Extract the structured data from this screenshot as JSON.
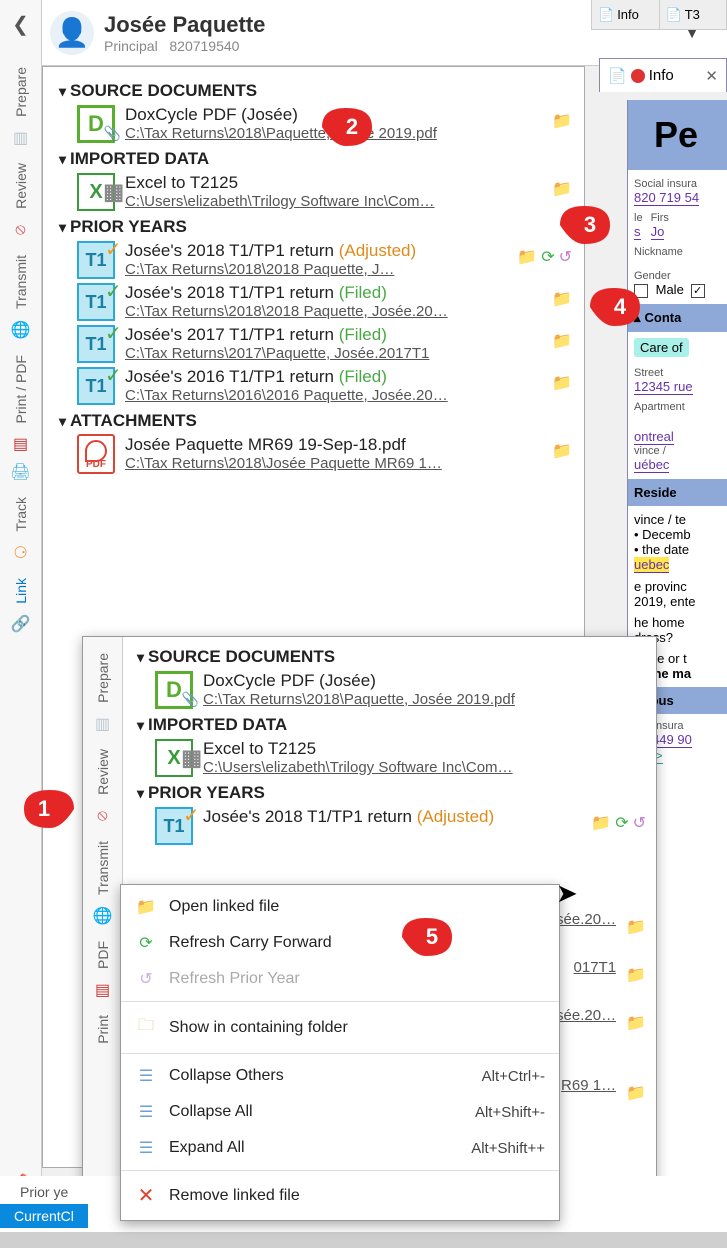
{
  "header": {
    "name": "Josée Paquette",
    "role": "Principal",
    "id": "820719540"
  },
  "rail": {
    "prepare": "Prepare",
    "review": "Review",
    "transmit": "Transmit",
    "printpdf": "Print / PDF",
    "track": "Track",
    "link": "Link"
  },
  "right_tabs": {
    "info": "Info",
    "t3": "T3"
  },
  "info_tab": {
    "label": "Info"
  },
  "right_pane": {
    "heading_fragment": "Pe",
    "sin_label": "Social insura",
    "sin": "820 719 54",
    "title_label": "le",
    "title_val": "s",
    "first_label": "Firs",
    "first_val": "Jo",
    "nickname_label": "Nickname",
    "gender_label": "Gender",
    "gender_male": "Male",
    "contact_hdr": "Conta",
    "careof": "Care of",
    "street_label": "Street",
    "street_val": "12345 rue",
    "apt_label": "Apartment",
    "city_val": "ontreal",
    "prov_label": "vince / ",
    "prov_val": "uébec",
    "resid_hdr": "Reside",
    "bullet1": "vince / te",
    "bullet1b": "• Decemb",
    "bullet2": "• the date",
    "highlight": "uebec",
    "line_prov": "e provinc",
    "line_2019": "2019, ente",
    "line_home1": "he home",
    "line_home2": "dress?",
    "line_vince": "vince or t",
    "line_ma": "in the ma",
    "spous_hdr": "Spous",
    "sp_sin_label": "cial insura",
    "sp_sin": "72 449 90",
    "sp_ank": "ank>"
  },
  "tree": {
    "sections": {
      "src": "SOURCE DOCUMENTS",
      "imp": "IMPORTED DATA",
      "prior": "PRIOR YEARS",
      "att": "ATTACHMENTS"
    },
    "src_doc": {
      "title": "DoxCycle PDF (Josée)",
      "path": "C:\\Tax Returns\\2018\\Paquette, Josée 2019.pdf"
    },
    "imp_doc": {
      "title": "Excel to T2125",
      "path": "C:\\Users\\elizabeth\\Trilogy Software Inc\\Com…"
    },
    "prior": [
      {
        "title": "Josée's 2018 T1/TP1 return",
        "status": "(Adjusted)",
        "status_class": "adj",
        "path": "C:\\Tax Returns\\2018\\2018 Paquette, J…",
        "extra_icons": true
      },
      {
        "title": "Josée's 2018 T1/TP1 return",
        "status": "(Filed)",
        "status_class": "filed",
        "path": "C:\\Tax Returns\\2018\\2018 Paquette, Josée.20…"
      },
      {
        "title": "Josée's 2017 T1/TP1 return",
        "status": "(Filed)",
        "status_class": "filed",
        "path": "C:\\Tax Returns\\2017\\Paquette, Josée.2017T1"
      },
      {
        "title": "Josée's 2016 T1/TP1 return",
        "status": "(Filed)",
        "status_class": "filed",
        "path": "C:\\Tax Returns\\2016\\2016 Paquette, Josée.20…"
      }
    ],
    "att_doc": {
      "title": "Josée Paquette MR69  19-Sep-18.pdf",
      "path": "C:\\Tax Returns\\2018\\Josée Paquette MR69  1…"
    }
  },
  "overlay_prior": [
    {
      "title": "Josée's 2018 T1/TP1 return",
      "status": "(Adjusted)",
      "status_class": "adj",
      "extra_icons": true
    },
    {
      "path": "osée.20…"
    },
    {
      "path": "017T1"
    },
    {
      "path": "osée.20…"
    },
    {
      "path": "R69  1…"
    }
  ],
  "context_menu": {
    "open": "Open linked file",
    "refresh_cf": "Refresh Carry Forward",
    "refresh_py": "Refresh Prior Year",
    "show": "Show in containing folder",
    "collapse_others": "Collapse Others",
    "collapse_others_k": "Alt+Ctrl+-",
    "collapse_all": "Collapse All",
    "collapse_all_k": "Alt+Shift+-",
    "expand_all": "Expand All",
    "expand_all_k": "Alt+Shift++",
    "remove": "Remove linked file"
  },
  "footer": {
    "prior": "Prior ye",
    "current": "CurrentCl",
    "print": "Print"
  },
  "callouts": {
    "1": "1",
    "2": "2",
    "3": "3",
    "4": "4",
    "5": "5"
  }
}
